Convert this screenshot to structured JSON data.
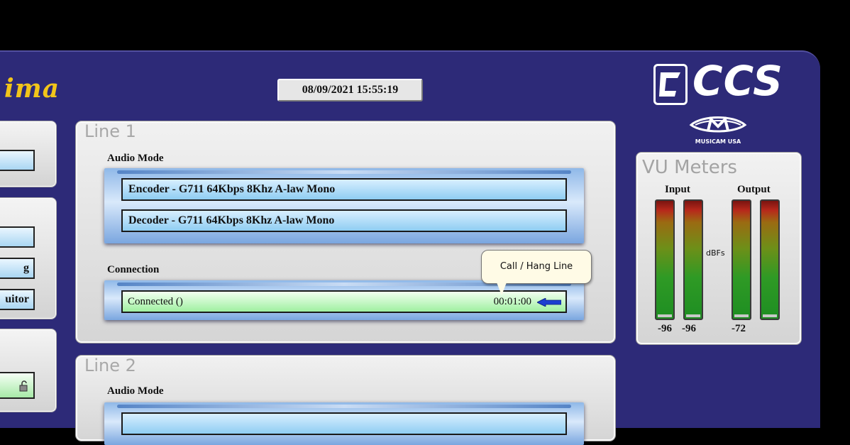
{
  "app": {
    "brand_fragment": "ima",
    "datetime": "08/09/2021 15:55:19"
  },
  "left_panel": {
    "buttons": [
      {
        "label": ""
      },
      {
        "label": ""
      },
      {
        "label": "g"
      },
      {
        "label": "uitor"
      },
      {
        "label": ""
      }
    ]
  },
  "line1": {
    "title": "Line 1",
    "audio_mode_label": "Audio Mode",
    "encoder": "Encoder -  G711 64Kbps 8Khz A-law Mono",
    "decoder": "Decoder -  G711 64Kbps 8Khz A-law Mono",
    "connection_label": "Connection",
    "connection_status": "Connected ()",
    "connection_timer": "00:01:00"
  },
  "line2": {
    "title": "Line 2",
    "audio_mode_label": "Audio Mode"
  },
  "tooltip": {
    "text": "Call / Hang Line"
  },
  "logo": {
    "text": "CCS",
    "subtext": "MUSICAM USA"
  },
  "vu_meters": {
    "title": "VU Meters",
    "input_label": "Input",
    "output_label": "Output",
    "unit": "dBFs",
    "values": [
      "-96",
      "-96",
      "-72"
    ],
    "colors": {
      "top": "#7a1410",
      "mid": "#6e8f18",
      "bottom": "#1e8e22"
    }
  },
  "colors": {
    "background": "#2d2a78",
    "brand": "#f2c51a",
    "panel": "#e6e6e6",
    "codec": "#8fcdf2",
    "connection": "#9ff0a0"
  }
}
